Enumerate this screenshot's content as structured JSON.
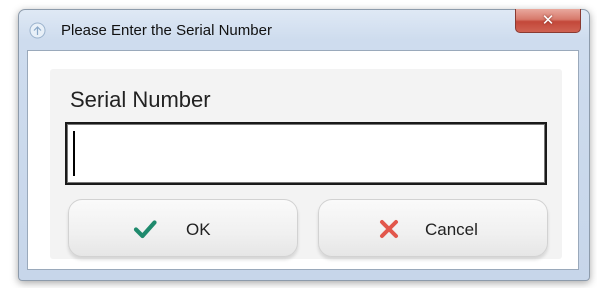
{
  "window": {
    "title": "Please Enter the Serial Number",
    "close_glyph": "✕"
  },
  "form": {
    "label": "Serial Number",
    "serial_value": "",
    "serial_placeholder": ""
  },
  "buttons": {
    "ok": {
      "label": "OK",
      "icon": "checkmark-icon",
      "color": "#1f8a6d"
    },
    "cancel": {
      "label": "Cancel",
      "icon": "cross-icon",
      "color": "#e2574c"
    }
  },
  "colors": {
    "close_button": "#c7473a",
    "title_bar": "#cedcee"
  }
}
